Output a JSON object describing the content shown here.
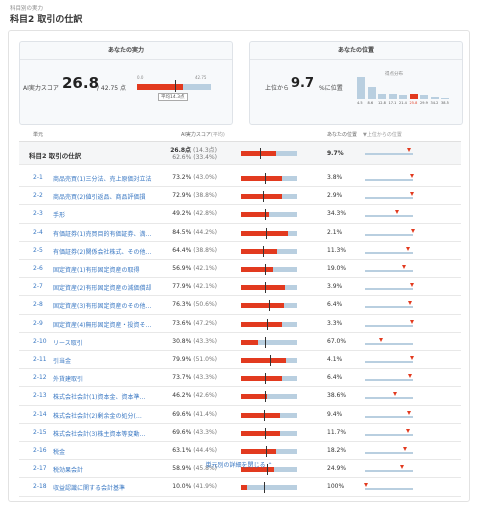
{
  "breadcrumb": "科目別の実力",
  "page_title": "科目2 取引の仕訳",
  "left_panel": {
    "title": "あなたの実力",
    "score_label": "AI実力スコア",
    "score": "26.8",
    "score_max": "/ 42.75 点",
    "gauge_min": "0.0",
    "gauge_max": "42.75",
    "gauge_fraction": 0.627,
    "average_label": "平均14.3点"
  },
  "right_panel": {
    "title": "あなたの位置",
    "prefix": "上位から",
    "value": "9.7",
    "suffix": "%に位置",
    "histogram_title": "得点分布",
    "histogram_labels": [
      "4.5",
      "8.6",
      "12.8",
      "17.1",
      "21.4",
      "25.8",
      "29.9",
      "34.2",
      "38.5"
    ],
    "histogram_levels": [
      1.0,
      0.55,
      0.25,
      0.22,
      0.2,
      0.22,
      0.18,
      0.1,
      0.06
    ],
    "histogram_highlight_index": 5
  },
  "columns": {
    "unit": "単元",
    "ai_score": "AI実力スコア",
    "ai_score_note": "(平均)",
    "position": "あなたの位置",
    "position_legend": "▼上位からの位置"
  },
  "total_row": {
    "name": "科目2 取引の仕訳",
    "score": "26.8点",
    "score_avg": "(14.3点)",
    "rate": "62.6%",
    "rate_avg": "(33.4%)",
    "position": "9.7%",
    "fill": 0.626,
    "avg": 0.334,
    "pos_fraction": 0.097
  },
  "units": [
    {
      "num": "2-1",
      "name": "商品売買(1)三分法、売上原価対立法",
      "rate": "73.2%",
      "avg": "(43.0%)",
      "position": "3.8%",
      "fill": 0.732,
      "avg_fraction": 0.43,
      "pos_fraction": 0.038
    },
    {
      "num": "2-2",
      "name": "商品売買(2)値引返品、商品評価損",
      "rate": "72.9%",
      "avg": "(38.8%)",
      "position": "2.9%",
      "fill": 0.729,
      "avg_fraction": 0.388,
      "pos_fraction": 0.029
    },
    {
      "num": "2-3",
      "name": "手形",
      "rate": "49.2%",
      "avg": "(42.8%)",
      "position": "34.3%",
      "fill": 0.492,
      "avg_fraction": 0.428,
      "pos_fraction": 0.343
    },
    {
      "num": "2-4",
      "name": "有価証券(1)売買目的有価証券、満…",
      "rate": "84.5%",
      "avg": "(44.2%)",
      "position": "2.1%",
      "fill": 0.845,
      "avg_fraction": 0.442,
      "pos_fraction": 0.021
    },
    {
      "num": "2-5",
      "name": "有価証券(2)関係会社株式、その他…",
      "rate": "64.4%",
      "avg": "(38.8%)",
      "position": "11.3%",
      "fill": 0.644,
      "avg_fraction": 0.388,
      "pos_fraction": 0.113
    },
    {
      "num": "2-6",
      "name": "固定資産(1)有形固定資産の取得",
      "rate": "56.9%",
      "avg": "(42.1%)",
      "position": "19.0%",
      "fill": 0.569,
      "avg_fraction": 0.421,
      "pos_fraction": 0.19
    },
    {
      "num": "2-7",
      "name": "固定資産(2)有形固定資産の減価償却",
      "rate": "77.9%",
      "avg": "(42.1%)",
      "position": "3.9%",
      "fill": 0.779,
      "avg_fraction": 0.421,
      "pos_fraction": 0.039
    },
    {
      "num": "2-8",
      "name": "固定資産(3)有形固定資産のその他…",
      "rate": "76.3%",
      "avg": "(50.6%)",
      "position": "6.4%",
      "fill": 0.763,
      "avg_fraction": 0.506,
      "pos_fraction": 0.064
    },
    {
      "num": "2-9",
      "name": "固定資産(4)無形固定資産・投資そ…",
      "rate": "73.6%",
      "avg": "(47.2%)",
      "position": "3.3%",
      "fill": 0.736,
      "avg_fraction": 0.472,
      "pos_fraction": 0.033
    },
    {
      "num": "2-10",
      "name": "リース取引",
      "rate": "30.8%",
      "avg": "(43.3%)",
      "position": "67.0%",
      "fill": 0.308,
      "avg_fraction": 0.433,
      "pos_fraction": 0.67
    },
    {
      "num": "2-11",
      "name": "引当金",
      "rate": "79.9%",
      "avg": "(51.0%)",
      "position": "4.1%",
      "fill": 0.799,
      "avg_fraction": 0.51,
      "pos_fraction": 0.041
    },
    {
      "num": "2-12",
      "name": "外貨建取引",
      "rate": "73.7%",
      "avg": "(43.3%)",
      "position": "6.4%",
      "fill": 0.737,
      "avg_fraction": 0.433,
      "pos_fraction": 0.064
    },
    {
      "num": "2-13",
      "name": "株式会社会計(1)資本金、資本準…",
      "rate": "46.2%",
      "avg": "(42.6%)",
      "position": "38.6%",
      "fill": 0.462,
      "avg_fraction": 0.426,
      "pos_fraction": 0.386
    },
    {
      "num": "2-14",
      "name": "株式会社会計(2)剰余金の処分(…",
      "rate": "69.6%",
      "avg": "(41.4%)",
      "position": "9.4%",
      "fill": 0.696,
      "avg_fraction": 0.414,
      "pos_fraction": 0.094
    },
    {
      "num": "2-15",
      "name": "株式会社会計(3)株主資本等変動…",
      "rate": "69.6%",
      "avg": "(43.3%)",
      "position": "11.7%",
      "fill": 0.696,
      "avg_fraction": 0.433,
      "pos_fraction": 0.117
    },
    {
      "num": "2-16",
      "name": "税金",
      "rate": "63.1%",
      "avg": "(44.4%)",
      "position": "18.2%",
      "fill": 0.631,
      "avg_fraction": 0.444,
      "pos_fraction": 0.182
    },
    {
      "num": "2-17",
      "name": "税効果会計",
      "rate": "58.9%",
      "avg": "(45.8%)",
      "position": "24.9%",
      "fill": 0.589,
      "avg_fraction": 0.458,
      "pos_fraction": 0.249
    },
    {
      "num": "2-18",
      "name": "収益認識に関する会計基準",
      "rate": "10.0%",
      "avg": "(41.9%)",
      "position": "100%",
      "fill": 0.1,
      "avg_fraction": 0.419,
      "pos_fraction": 1.0
    }
  ],
  "collapse_label": "単元別の詳細を閉じる ⌃",
  "colors": {
    "accent": "#e23a1f",
    "bar_bg": "#b9cfe0",
    "link": "#3a78c3"
  }
}
